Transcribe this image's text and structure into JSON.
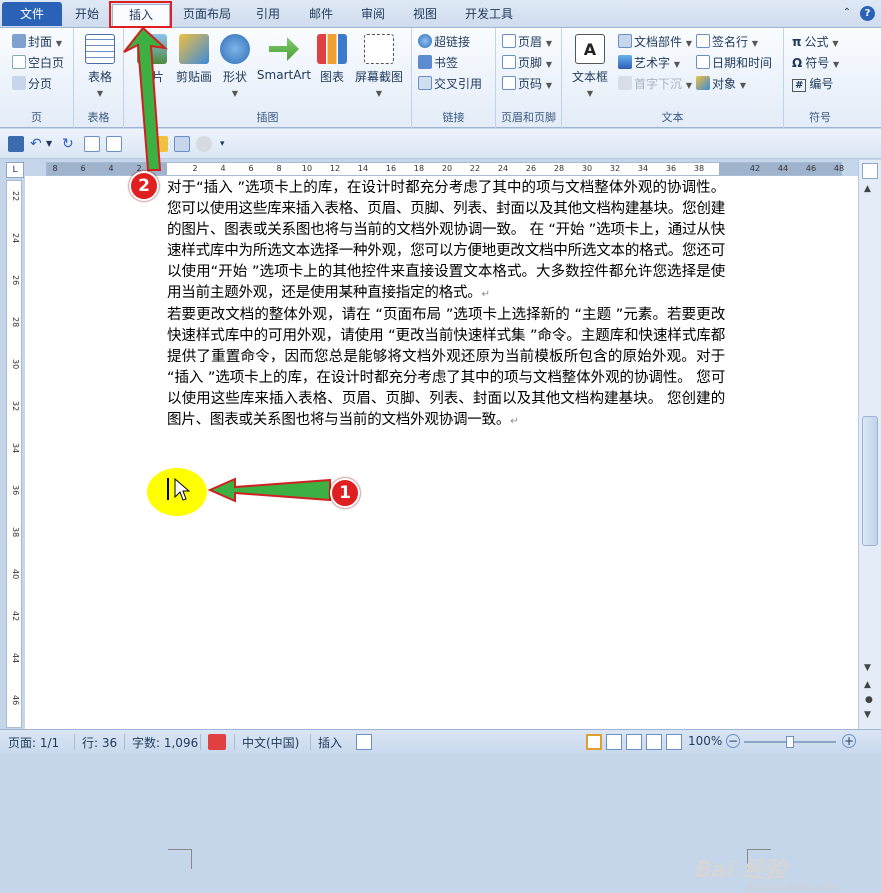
{
  "menubar": {
    "tabs": [
      "文件",
      "开始",
      "插入",
      "页面布局",
      "引用",
      "邮件",
      "审阅",
      "视图",
      "开发工具"
    ],
    "right_icons": [
      "collapse-ribbon-icon",
      "help-icon"
    ]
  },
  "ribbon": {
    "groups": {
      "pages": {
        "label": "页",
        "items": [
          "封面",
          "空白页",
          "分页"
        ]
      },
      "tables": {
        "label": "表格",
        "item": "表格"
      },
      "illustrations": {
        "label": "插图",
        "items": [
          "图片",
          "剪贴画",
          "形状",
          "SmartArt",
          "图表",
          "屏幕截图"
        ]
      },
      "links": {
        "label": "链接",
        "items": [
          "超链接",
          "书签",
          "交叉引用"
        ]
      },
      "header_footer": {
        "label": "页眉和页脚",
        "items": [
          "页眉",
          "页脚",
          "页码"
        ]
      },
      "text": {
        "label": "文本",
        "big": "文本框",
        "col1": [
          "文档部件",
          "艺术字",
          "首字下沉"
        ],
        "col2": [
          "签名行",
          "日期和时间",
          "对象"
        ]
      },
      "symbols": {
        "label": "符号",
        "items": [
          "公式",
          "符号",
          "编号"
        ]
      }
    }
  },
  "ruler": {
    "numbers": [
      "8",
      "6",
      "4",
      "2",
      "",
      "2",
      "4",
      "6",
      "8",
      "10",
      "12",
      "14",
      "16",
      "18",
      "20",
      "22",
      "24",
      "26",
      "28",
      "30",
      "32",
      "34",
      "36",
      "38",
      "",
      "42",
      "44",
      "46",
      "48"
    ]
  },
  "vruler": {
    "numbers": [
      "22",
      "24",
      "26",
      "28",
      "30",
      "32",
      "34",
      "36",
      "38",
      "40",
      "42",
      "44",
      "46"
    ]
  },
  "document": {
    "paragraphs": [
      "对于“插入 ”选项卡上的库，在设计时都充分考虑了其中的项与文档整体外观的协调性。 您可以使用这些库来插入表格、页眉、页脚、列表、封面以及其他文档构建基块。您创建的图片、图表或关系图也将与当前的文档外观协调一致。 在 “开始 ”选项卡上，通过从快速样式库中为所选文本选择一种外观，您可以方便地更改文档中所选文本的格式。您还可以使用“开始 ”选项卡上的其他控件来直接设置文本格式。大多数控件都允许您选择是使用当前主题外观，还是使用某种直接指定的格式。",
      "若要更改文档的整体外观，请在 “页面布局 ”选项卡上选择新的 “主题 ”元素。若要更改快速样式库中的可用外观，请使用 “更改当前快速样式集 ”命令。主题库和快速样式库都提供了重置命令，因而您总是能够将文档外观还原为当前模板所包含的原始外观。对于 “插入 ”选项卡上的库，在设计时都充分考虑了其中的项与文档整体外观的协调性。 您可以使用这些库来插入表格、页眉、页脚、列表、封面以及其他文档构建基块。 您创建的图片、图表或关系图也将与当前的文档外观协调一致。"
    ],
    "pilcrow": "↵"
  },
  "annotations": {
    "badge1": "1",
    "badge2": "2"
  },
  "statusbar": {
    "page": "页面: 1/1",
    "line": "行: 36",
    "words": "字数: 1,096",
    "language": "中文(中国)",
    "mode": "插入",
    "zoom": "100%"
  },
  "watermark": {
    "main": "Bai 经验",
    "sub": "jingyan.baidu.com"
  }
}
